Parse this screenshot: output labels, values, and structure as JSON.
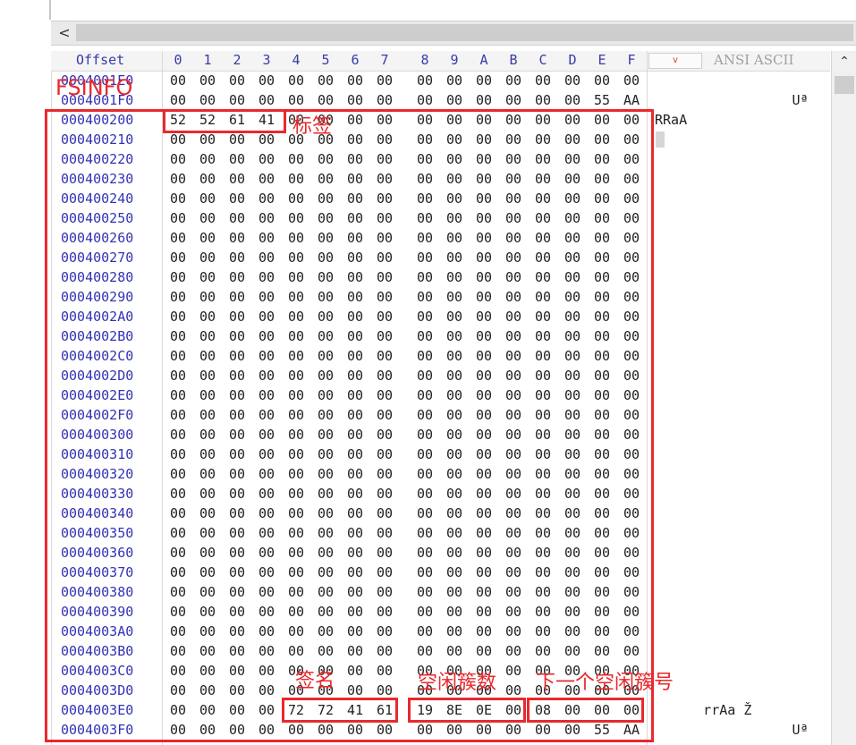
{
  "toolbar": {
    "left_arrow": "<"
  },
  "header": {
    "offset_label": "Offset",
    "columns": [
      "0",
      "1",
      "2",
      "3",
      "4",
      "5",
      "6",
      "7",
      "8",
      "9",
      "A",
      "B",
      "C",
      "D",
      "E",
      "F"
    ],
    "dropdown_label": "v",
    "ansi_label": "ANSI ASCII"
  },
  "rows": [
    {
      "offset": "0004001E0",
      "bytes": [
        "00",
        "00",
        "00",
        "00",
        "00",
        "00",
        "00",
        "00",
        "00",
        "00",
        "00",
        "00",
        "00",
        "00",
        "00",
        "00"
      ],
      "ascii": ""
    },
    {
      "offset": "0004001F0",
      "bytes": [
        "00",
        "00",
        "00",
        "00",
        "00",
        "00",
        "00",
        "00",
        "00",
        "00",
        "00",
        "00",
        "00",
        "00",
        "55",
        "AA"
      ],
      "ascii": "                 Uª"
    },
    {
      "offset": "000400200",
      "bytes": [
        "52",
        "52",
        "61",
        "41",
        "00",
        "00",
        "00",
        "00",
        "00",
        "00",
        "00",
        "00",
        "00",
        "00",
        "00",
        "00"
      ],
      "ascii": "RRaA"
    },
    {
      "offset": "000400210",
      "bytes": [
        "00",
        "00",
        "00",
        "00",
        "00",
        "00",
        "00",
        "00",
        "00",
        "00",
        "00",
        "00",
        "00",
        "00",
        "00",
        "00"
      ],
      "ascii": ""
    },
    {
      "offset": "000400220",
      "bytes": [
        "00",
        "00",
        "00",
        "00",
        "00",
        "00",
        "00",
        "00",
        "00",
        "00",
        "00",
        "00",
        "00",
        "00",
        "00",
        "00"
      ],
      "ascii": ""
    },
    {
      "offset": "000400230",
      "bytes": [
        "00",
        "00",
        "00",
        "00",
        "00",
        "00",
        "00",
        "00",
        "00",
        "00",
        "00",
        "00",
        "00",
        "00",
        "00",
        "00"
      ],
      "ascii": ""
    },
    {
      "offset": "000400240",
      "bytes": [
        "00",
        "00",
        "00",
        "00",
        "00",
        "00",
        "00",
        "00",
        "00",
        "00",
        "00",
        "00",
        "00",
        "00",
        "00",
        "00"
      ],
      "ascii": ""
    },
    {
      "offset": "000400250",
      "bytes": [
        "00",
        "00",
        "00",
        "00",
        "00",
        "00",
        "00",
        "00",
        "00",
        "00",
        "00",
        "00",
        "00",
        "00",
        "00",
        "00"
      ],
      "ascii": ""
    },
    {
      "offset": "000400260",
      "bytes": [
        "00",
        "00",
        "00",
        "00",
        "00",
        "00",
        "00",
        "00",
        "00",
        "00",
        "00",
        "00",
        "00",
        "00",
        "00",
        "00"
      ],
      "ascii": ""
    },
    {
      "offset": "000400270",
      "bytes": [
        "00",
        "00",
        "00",
        "00",
        "00",
        "00",
        "00",
        "00",
        "00",
        "00",
        "00",
        "00",
        "00",
        "00",
        "00",
        "00"
      ],
      "ascii": ""
    },
    {
      "offset": "000400280",
      "bytes": [
        "00",
        "00",
        "00",
        "00",
        "00",
        "00",
        "00",
        "00",
        "00",
        "00",
        "00",
        "00",
        "00",
        "00",
        "00",
        "00"
      ],
      "ascii": ""
    },
    {
      "offset": "000400290",
      "bytes": [
        "00",
        "00",
        "00",
        "00",
        "00",
        "00",
        "00",
        "00",
        "00",
        "00",
        "00",
        "00",
        "00",
        "00",
        "00",
        "00"
      ],
      "ascii": ""
    },
    {
      "offset": "0004002A0",
      "bytes": [
        "00",
        "00",
        "00",
        "00",
        "00",
        "00",
        "00",
        "00",
        "00",
        "00",
        "00",
        "00",
        "00",
        "00",
        "00",
        "00"
      ],
      "ascii": ""
    },
    {
      "offset": "0004002B0",
      "bytes": [
        "00",
        "00",
        "00",
        "00",
        "00",
        "00",
        "00",
        "00",
        "00",
        "00",
        "00",
        "00",
        "00",
        "00",
        "00",
        "00"
      ],
      "ascii": ""
    },
    {
      "offset": "0004002C0",
      "bytes": [
        "00",
        "00",
        "00",
        "00",
        "00",
        "00",
        "00",
        "00",
        "00",
        "00",
        "00",
        "00",
        "00",
        "00",
        "00",
        "00"
      ],
      "ascii": ""
    },
    {
      "offset": "0004002D0",
      "bytes": [
        "00",
        "00",
        "00",
        "00",
        "00",
        "00",
        "00",
        "00",
        "00",
        "00",
        "00",
        "00",
        "00",
        "00",
        "00",
        "00"
      ],
      "ascii": ""
    },
    {
      "offset": "0004002E0",
      "bytes": [
        "00",
        "00",
        "00",
        "00",
        "00",
        "00",
        "00",
        "00",
        "00",
        "00",
        "00",
        "00",
        "00",
        "00",
        "00",
        "00"
      ],
      "ascii": ""
    },
    {
      "offset": "0004002F0",
      "bytes": [
        "00",
        "00",
        "00",
        "00",
        "00",
        "00",
        "00",
        "00",
        "00",
        "00",
        "00",
        "00",
        "00",
        "00",
        "00",
        "00"
      ],
      "ascii": ""
    },
    {
      "offset": "000400300",
      "bytes": [
        "00",
        "00",
        "00",
        "00",
        "00",
        "00",
        "00",
        "00",
        "00",
        "00",
        "00",
        "00",
        "00",
        "00",
        "00",
        "00"
      ],
      "ascii": ""
    },
    {
      "offset": "000400310",
      "bytes": [
        "00",
        "00",
        "00",
        "00",
        "00",
        "00",
        "00",
        "00",
        "00",
        "00",
        "00",
        "00",
        "00",
        "00",
        "00",
        "00"
      ],
      "ascii": ""
    },
    {
      "offset": "000400320",
      "bytes": [
        "00",
        "00",
        "00",
        "00",
        "00",
        "00",
        "00",
        "00",
        "00",
        "00",
        "00",
        "00",
        "00",
        "00",
        "00",
        "00"
      ],
      "ascii": ""
    },
    {
      "offset": "000400330",
      "bytes": [
        "00",
        "00",
        "00",
        "00",
        "00",
        "00",
        "00",
        "00",
        "00",
        "00",
        "00",
        "00",
        "00",
        "00",
        "00",
        "00"
      ],
      "ascii": ""
    },
    {
      "offset": "000400340",
      "bytes": [
        "00",
        "00",
        "00",
        "00",
        "00",
        "00",
        "00",
        "00",
        "00",
        "00",
        "00",
        "00",
        "00",
        "00",
        "00",
        "00"
      ],
      "ascii": ""
    },
    {
      "offset": "000400350",
      "bytes": [
        "00",
        "00",
        "00",
        "00",
        "00",
        "00",
        "00",
        "00",
        "00",
        "00",
        "00",
        "00",
        "00",
        "00",
        "00",
        "00"
      ],
      "ascii": ""
    },
    {
      "offset": "000400360",
      "bytes": [
        "00",
        "00",
        "00",
        "00",
        "00",
        "00",
        "00",
        "00",
        "00",
        "00",
        "00",
        "00",
        "00",
        "00",
        "00",
        "00"
      ],
      "ascii": ""
    },
    {
      "offset": "000400370",
      "bytes": [
        "00",
        "00",
        "00",
        "00",
        "00",
        "00",
        "00",
        "00",
        "00",
        "00",
        "00",
        "00",
        "00",
        "00",
        "00",
        "00"
      ],
      "ascii": ""
    },
    {
      "offset": "000400380",
      "bytes": [
        "00",
        "00",
        "00",
        "00",
        "00",
        "00",
        "00",
        "00",
        "00",
        "00",
        "00",
        "00",
        "00",
        "00",
        "00",
        "00"
      ],
      "ascii": ""
    },
    {
      "offset": "000400390",
      "bytes": [
        "00",
        "00",
        "00",
        "00",
        "00",
        "00",
        "00",
        "00",
        "00",
        "00",
        "00",
        "00",
        "00",
        "00",
        "00",
        "00"
      ],
      "ascii": ""
    },
    {
      "offset": "0004003A0",
      "bytes": [
        "00",
        "00",
        "00",
        "00",
        "00",
        "00",
        "00",
        "00",
        "00",
        "00",
        "00",
        "00",
        "00",
        "00",
        "00",
        "00"
      ],
      "ascii": ""
    },
    {
      "offset": "0004003B0",
      "bytes": [
        "00",
        "00",
        "00",
        "00",
        "00",
        "00",
        "00",
        "00",
        "00",
        "00",
        "00",
        "00",
        "00",
        "00",
        "00",
        "00"
      ],
      "ascii": ""
    },
    {
      "offset": "0004003C0",
      "bytes": [
        "00",
        "00",
        "00",
        "00",
        "00",
        "00",
        "00",
        "00",
        "00",
        "00",
        "00",
        "00",
        "00",
        "00",
        "00",
        "00"
      ],
      "ascii": ""
    },
    {
      "offset": "0004003D0",
      "bytes": [
        "00",
        "00",
        "00",
        "00",
        "00",
        "00",
        "00",
        "00",
        "00",
        "00",
        "00",
        "00",
        "00",
        "00",
        "00",
        "00"
      ],
      "ascii": ""
    },
    {
      "offset": "0004003E0",
      "bytes": [
        "00",
        "00",
        "00",
        "00",
        "72",
        "72",
        "41",
        "61",
        "19",
        "8E",
        "0E",
        "00",
        "08",
        "00",
        "00",
        "00"
      ],
      "ascii": "      rrAa Ž"
    },
    {
      "offset": "0004003F0",
      "bytes": [
        "00",
        "00",
        "00",
        "00",
        "00",
        "00",
        "00",
        "00",
        "00",
        "00",
        "00",
        "00",
        "00",
        "00",
        "55",
        "AA"
      ],
      "ascii": "                 Uª"
    }
  ],
  "annotations": {
    "fsinfo": "FSINFO",
    "tag_label": "标签",
    "signature": "签名",
    "free_clusters": "空闲簇数",
    "next_free_cluster": "下一个空闲簇号"
  },
  "colors": {
    "annotation": "#e8292d",
    "offset_text": "#3333b3"
  }
}
